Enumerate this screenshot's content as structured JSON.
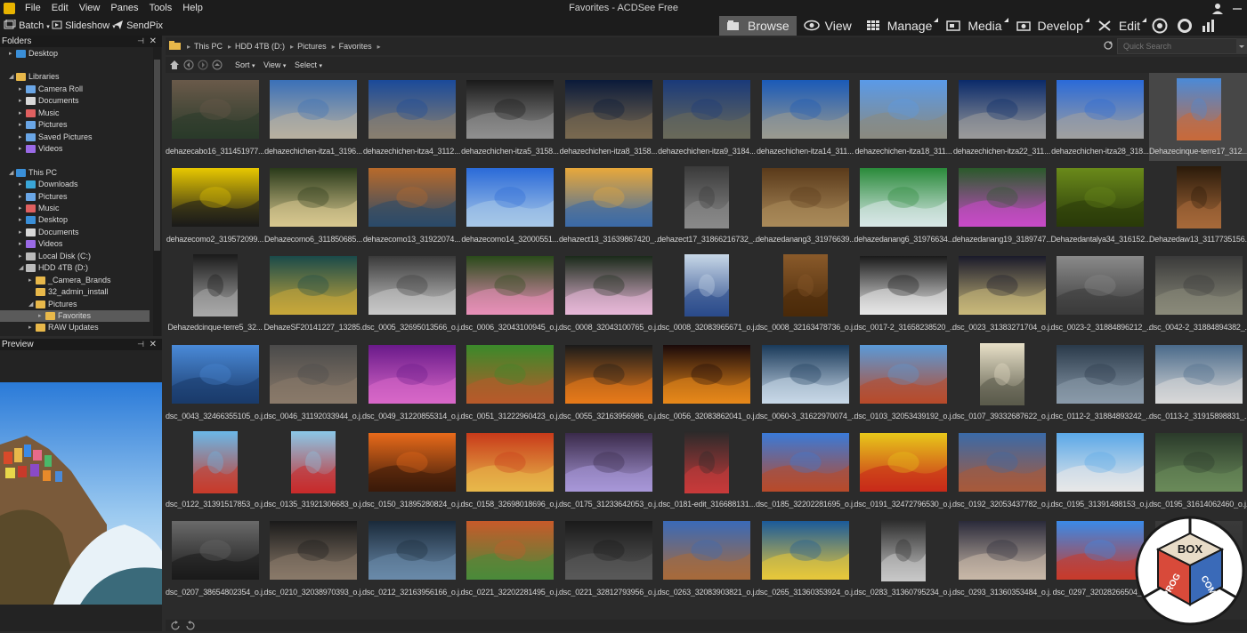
{
  "window": {
    "title": "Favorites - ACDSee Free"
  },
  "menu": [
    "File",
    "Edit",
    "View",
    "Panes",
    "Tools",
    "Help"
  ],
  "toolbar2": {
    "batch": "Batch",
    "slideshow": "Slideshow",
    "sendpix": "SendPix"
  },
  "modes": [
    {
      "label": "Browse",
      "icon": "browse-icon",
      "active": true
    },
    {
      "label": "View",
      "icon": "eye-icon",
      "active": false
    },
    {
      "label": "Manage",
      "icon": "grid-icon",
      "active": false
    },
    {
      "label": "Media",
      "icon": "media-icon",
      "active": false
    },
    {
      "label": "Develop",
      "icon": "develop-icon",
      "active": false
    },
    {
      "label": "Edit",
      "icon": "tools-icon",
      "active": false
    }
  ],
  "panes": {
    "folders": "Folders",
    "preview": "Preview"
  },
  "tree": [
    {
      "label": "Desktop",
      "indent": 0,
      "arrow": "▸",
      "color": "#3a8fd8"
    },
    {
      "label": "Libraries",
      "indent": 0,
      "arrow": "◢",
      "color": "#e8b84a"
    },
    {
      "label": "Camera Roll",
      "indent": 1,
      "arrow": "▸",
      "color": "#6aa6e6"
    },
    {
      "label": "Documents",
      "indent": 1,
      "arrow": "▸",
      "color": "#d8d8d8"
    },
    {
      "label": "Music",
      "indent": 1,
      "arrow": "▸",
      "color": "#e06060"
    },
    {
      "label": "Pictures",
      "indent": 1,
      "arrow": "▸",
      "color": "#6aa6e6"
    },
    {
      "label": "Saved Pictures",
      "indent": 1,
      "arrow": "▸",
      "color": "#6aa6e6"
    },
    {
      "label": "Videos",
      "indent": 1,
      "arrow": "▸",
      "color": "#9a6ae6"
    },
    {
      "label": "This PC",
      "indent": 0,
      "arrow": "◢",
      "color": "#3a8fd8"
    },
    {
      "label": "Downloads",
      "indent": 1,
      "arrow": "▸",
      "color": "#3aa6d8"
    },
    {
      "label": "Pictures",
      "indent": 1,
      "arrow": "▸",
      "color": "#6aa6e6"
    },
    {
      "label": "Music",
      "indent": 1,
      "arrow": "▸",
      "color": "#e06060"
    },
    {
      "label": "Desktop",
      "indent": 1,
      "arrow": "▸",
      "color": "#3a8fd8"
    },
    {
      "label": "Documents",
      "indent": 1,
      "arrow": "▸",
      "color": "#d8d8d8"
    },
    {
      "label": "Videos",
      "indent": 1,
      "arrow": "▸",
      "color": "#9a6ae6"
    },
    {
      "label": "Local Disk (C:)",
      "indent": 1,
      "arrow": "▸",
      "color": "#bbbbbb"
    },
    {
      "label": "HDD 4TB (D:)",
      "indent": 1,
      "arrow": "◢",
      "color": "#bbbbbb"
    },
    {
      "label": "_Camera_Brands",
      "indent": 2,
      "arrow": "▸",
      "color": "#e8b84a"
    },
    {
      "label": "32_admin_install",
      "indent": 2,
      "arrow": "",
      "color": "#e8b84a"
    },
    {
      "label": "Pictures",
      "indent": 2,
      "arrow": "◢",
      "color": "#e8b84a"
    },
    {
      "label": "Favorites",
      "indent": 3,
      "arrow": "▸",
      "color": "#e8b84a",
      "selected": true
    },
    {
      "label": "RAW Updates",
      "indent": 2,
      "arrow": "▸",
      "color": "#e8b84a"
    }
  ],
  "breadcrumb": [
    "This PC",
    "HDD 4TB (D:)",
    "Pictures",
    "Favorites"
  ],
  "search": {
    "placeholder": "Quick Search"
  },
  "filters": {
    "sort": "Sort",
    "view": "View",
    "select": "Select"
  },
  "thumbnails": [
    {
      "name": "dehazecabo16_311451977...",
      "colors": [
        "#6a5a4a",
        "#2a3a2a"
      ],
      "shape": "land"
    },
    {
      "name": "dehazechichen-itza1_3196...",
      "colors": [
        "#3a70b8",
        "#b8b0a0"
      ],
      "shape": "land"
    },
    {
      "name": "dehazechichen-itza4_3112...",
      "colors": [
        "#1a4a9a",
        "#8a8070"
      ],
      "shape": "land"
    },
    {
      "name": "dehazechichen-itza5_3158...",
      "colors": [
        "#1a1a1a",
        "#909090"
      ],
      "shape": "land"
    },
    {
      "name": "dehazechichen-itza8_3158...",
      "colors": [
        "#0a1a3a",
        "#7a6a50"
      ],
      "shape": "land"
    },
    {
      "name": "dehazechichen-itza9_3184...",
      "colors": [
        "#1a3a7a",
        "#6a6a5a"
      ],
      "shape": "land"
    },
    {
      "name": "dehazechichen-itza14_311...",
      "colors": [
        "#1a5ab8",
        "#9a9a90"
      ],
      "shape": "land"
    },
    {
      "name": "dehazechichen-itza18_311...",
      "colors": [
        "#5a9ae8",
        "#8a8a80"
      ],
      "shape": "land"
    },
    {
      "name": "dehazechichen-itza22_311...",
      "colors": [
        "#0a2a6a",
        "#9a9a9a"
      ],
      "shape": "land"
    },
    {
      "name": "dehazechichen-itza28_318...",
      "colors": [
        "#2a6ad8",
        "#a0a0a0"
      ],
      "shape": "land"
    },
    {
      "name": "Dehazecinque-terre17_312...",
      "colors": [
        "#4a8ad8",
        "#c86a3a"
      ],
      "shape": "portrait",
      "selected": true
    },
    {
      "name": "dehazecomo2_319572099...",
      "colors": [
        "#e8c800",
        "#1a1a1a"
      ],
      "shape": "land"
    },
    {
      "name": "Dehazecomo6_311850685...",
      "colors": [
        "#2a3a1a",
        "#d8c890"
      ],
      "shape": "land"
    },
    {
      "name": "dehazecomo13_31922074...",
      "colors": [
        "#b86a2a",
        "#2a4a6a"
      ],
      "shape": "land"
    },
    {
      "name": "dehazecomo14_32000551...",
      "colors": [
        "#2a6ad8",
        "#a8c8e8"
      ],
      "shape": "land"
    },
    {
      "name": "dehazect13_31639867420_...",
      "colors": [
        "#e8a83a",
        "#3a6aa8"
      ],
      "shape": "land"
    },
    {
      "name": "dehazect17_31866216732_...",
      "colors": [
        "#3a3a3a",
        "#8a8a8a"
      ],
      "shape": "portrait"
    },
    {
      "name": "dehazedanang3_31976639...",
      "colors": [
        "#5a3a1a",
        "#aa8a5a"
      ],
      "shape": "land"
    },
    {
      "name": "dehazedanang6_31976634...",
      "colors": [
        "#2a8a3a",
        "#d8e8e8"
      ],
      "shape": "land"
    },
    {
      "name": "dehazedanang19_3189747...",
      "colors": [
        "#2a5a2a",
        "#c84ac8"
      ],
      "shape": "land"
    },
    {
      "name": "Dehazedantalya34_316152...",
      "colors": [
        "#6a8a1a",
        "#2a3a0a"
      ],
      "shape": "land"
    },
    {
      "name": "Dehazedaw13_3117735156...",
      "colors": [
        "#2a1a0a",
        "#a86a3a"
      ],
      "shape": "portrait"
    },
    {
      "name": "Dehazedcinque-terre5_32...",
      "colors": [
        "#1a1a1a",
        "#aaaaaa"
      ],
      "shape": "portrait"
    },
    {
      "name": "DehazeSF20141227_13285...",
      "colors": [
        "#1a4a4a",
        "#c8a83a"
      ],
      "shape": "land"
    },
    {
      "name": "dsc_0005_32695013566_o.j...",
      "colors": [
        "#3a3a3a",
        "#c8c8c8"
      ],
      "shape": "land"
    },
    {
      "name": "dsc_0006_32043100945_o.j...",
      "colors": [
        "#2a4a1a",
        "#e890b8"
      ],
      "shape": "land"
    },
    {
      "name": "dsc_0008_32043100765_o.j...",
      "colors": [
        "#1a2a1a",
        "#e8b8d8"
      ],
      "shape": "land"
    },
    {
      "name": "dsc_0008_32083965671_o.j...",
      "colors": [
        "#c8d8e8",
        "#2a4a8a"
      ],
      "shape": "portrait"
    },
    {
      "name": "dsc_0008_32163478736_o.j...",
      "colors": [
        "#8a5a2a",
        "#4a2a0a"
      ],
      "shape": "portrait"
    },
    {
      "name": "dsc_0017-2_31658238520_...",
      "colors": [
        "#1a1a1a",
        "#e8e8e8"
      ],
      "shape": "land"
    },
    {
      "name": "dsc_0023_31383271704_o.j...",
      "colors": [
        "#1a1a2a",
        "#c8b87a"
      ],
      "shape": "land"
    },
    {
      "name": "dsc_0023-2_31884896212_...",
      "colors": [
        "#8a8a8a",
        "#3a3a3a"
      ],
      "shape": "land"
    },
    {
      "name": "dsc_0042-2_31884894382_...",
      "colors": [
        "#3a3a3a",
        "#8a8a7a"
      ],
      "shape": "land"
    },
    {
      "name": "dsc_0043_32466355105_o.j...",
      "colors": [
        "#4a8ad8",
        "#1a3a6a"
      ],
      "shape": "land"
    },
    {
      "name": "dsc_0046_31192033944_o.j...",
      "colors": [
        "#4a4a4a",
        "#8a7a6a"
      ],
      "shape": "land"
    },
    {
      "name": "dsc_0049_31220855314_o.j...",
      "colors": [
        "#6a1a8a",
        "#d868c8"
      ],
      "shape": "land"
    },
    {
      "name": "dsc_0051_31222960423_o.j...",
      "colors": [
        "#3a8a2a",
        "#b85a2a"
      ],
      "shape": "land"
    },
    {
      "name": "dsc_0055_32163956986_o.j...",
      "colors": [
        "#1a1a1a",
        "#e87a1a"
      ],
      "shape": "land"
    },
    {
      "name": "dsc_0056_32083862041_o.j...",
      "colors": [
        "#1a0a0a",
        "#e8881a"
      ],
      "shape": "land"
    },
    {
      "name": "dsc_0060-3_31622970074_...",
      "colors": [
        "#1a3a5a",
        "#c8d8e8"
      ],
      "shape": "land"
    },
    {
      "name": "dsc_0103_32053439192_o.j...",
      "colors": [
        "#5a9ad8",
        "#b84a2a"
      ],
      "shape": "land"
    },
    {
      "name": "dsc_0107_39332687622_o.j...",
      "colors": [
        "#e8e0c8",
        "#5a5a4a"
      ],
      "shape": "portrait"
    },
    {
      "name": "dsc_0112-2_31884893242_...",
      "colors": [
        "#2a3a4a",
        "#8a9aaa"
      ],
      "shape": "land"
    },
    {
      "name": "dsc_0113-2_31915898831_...",
      "colors": [
        "#4a6a8a",
        "#d8d8d8"
      ],
      "shape": "land"
    },
    {
      "name": "dsc_0122_31391517853_o.j...",
      "colors": [
        "#6ab8e8",
        "#c83a2a"
      ],
      "shape": "portrait"
    },
    {
      "name": "dsc_0135_31921306683_o.j...",
      "colors": [
        "#8ac8e8",
        "#c82a2a"
      ],
      "shape": "portrait"
    },
    {
      "name": "dsc_0150_31895280824_o.j...",
      "colors": [
        "#e86a1a",
        "#3a1a0a"
      ],
      "shape": "land"
    },
    {
      "name": "dsc_0158_32698018696_o.j...",
      "colors": [
        "#c83a1a",
        "#e8b84a"
      ],
      "shape": "land"
    },
    {
      "name": "dsc_0175_31233642053_o.j...",
      "colors": [
        "#3a2a4a",
        "#a898d8"
      ],
      "shape": "land"
    },
    {
      "name": "dsc_0181-edit_316688131...",
      "colors": [
        "#2a2a2a",
        "#c83a3a"
      ],
      "shape": "portrait"
    },
    {
      "name": "dsc_0185_32202281695_o.j...",
      "colors": [
        "#3a7ad8",
        "#b84a2a"
      ],
      "shape": "land"
    },
    {
      "name": "dsc_0191_32472796530_o.j...",
      "colors": [
        "#e8c81a",
        "#c82a1a"
      ],
      "shape": "land"
    },
    {
      "name": "dsc_0192_32053437782_o.j...",
      "colors": [
        "#3a6aa8",
        "#a85a3a"
      ],
      "shape": "land"
    },
    {
      "name": "dsc_0195_31391488153_o.j...",
      "colors": [
        "#5aa8e8",
        "#e8e8e8"
      ],
      "shape": "land"
    },
    {
      "name": "dsc_0195_31614062460_o.j...",
      "colors": [
        "#2a3a2a",
        "#6a8a5a"
      ],
      "shape": "land"
    },
    {
      "name": "dsc_0207_38654802354_o.j...",
      "colors": [
        "#6a6a6a",
        "#1a1a1a"
      ],
      "shape": "land"
    },
    {
      "name": "dsc_0210_32038970393_o.j...",
      "colors": [
        "#1a1a1a",
        "#8a7a6a"
      ],
      "shape": "land"
    },
    {
      "name": "dsc_0212_32163956166_o.j...",
      "colors": [
        "#1a2a3a",
        "#6a8aaa"
      ],
      "shape": "land"
    },
    {
      "name": "dsc_0221_32202281495_o.j...",
      "colors": [
        "#c85a2a",
        "#4a8a3a"
      ],
      "shape": "land"
    },
    {
      "name": "dsc_0221_32812793956_o.j...",
      "colors": [
        "#1a1a1a",
        "#5a5a5a"
      ],
      "shape": "land"
    },
    {
      "name": "dsc_0263_32083903821_o.j...",
      "colors": [
        "#3a6ab8",
        "#a86a3a"
      ],
      "shape": "land"
    },
    {
      "name": "dsc_0265_31360353924_o.j...",
      "colors": [
        "#1a5a9a",
        "#e8c83a"
      ],
      "shape": "land"
    },
    {
      "name": "dsc_0283_31360795234_o.j...",
      "colors": [
        "#2a2a2a",
        "#c8c8c8"
      ],
      "shape": "portrait"
    },
    {
      "name": "dsc_0293_31360353484_o.j...",
      "colors": [
        "#2a2a3a",
        "#c8b8a8"
      ],
      "shape": "land"
    },
    {
      "name": "dsc_0297_32028266504_...",
      "colors": [
        "#3a8ae8",
        "#c83a2a"
      ],
      "shape": "land"
    },
    {
      "name": "",
      "colors": [
        "#3a3a3a",
        "#2a2a2a"
      ],
      "shape": "land"
    }
  ],
  "colors": {
    "accent": "#e8b400",
    "selected": "#5a5a5a"
  },
  "watermark": {
    "line1": "BOX",
    "line2": "PROG",
    "line3": "COM"
  }
}
